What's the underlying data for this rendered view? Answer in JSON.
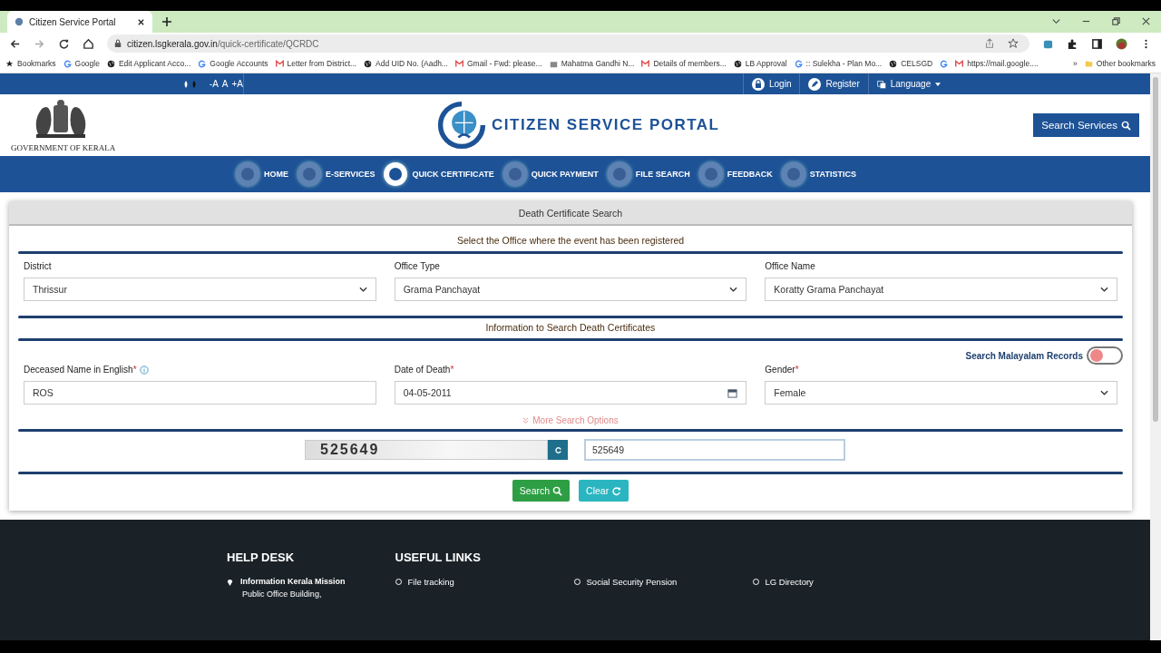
{
  "browser": {
    "tab_title": "Citizen Service Portal",
    "url_host": "citizen.lsgkerala.gov.in",
    "url_path": "/quick-certificate/QCRDC",
    "bookmarks": [
      {
        "label": "Bookmarks",
        "kind": "star"
      },
      {
        "label": "Google",
        "kind": "g"
      },
      {
        "label": "Edit Applicant Acco...",
        "kind": "globe"
      },
      {
        "label": "Google Accounts",
        "kind": "g"
      },
      {
        "label": "Letter from District...",
        "kind": "mail"
      },
      {
        "label": "Add UID No. (Aadh...",
        "kind": "globe"
      },
      {
        "label": "Gmail - Fwd: please...",
        "kind": "mail"
      },
      {
        "label": "Mahatma Gandhi N...",
        "kind": "site"
      },
      {
        "label": "Details of members...",
        "kind": "mail"
      },
      {
        "label": "LB Approval",
        "kind": "globe"
      },
      {
        "label": ":: Sulekha - Plan Mo...",
        "kind": "g"
      },
      {
        "label": "CELSGD",
        "kind": "globe"
      },
      {
        "kind": "g"
      },
      {
        "label": "https://mail.google....",
        "kind": "mail"
      }
    ],
    "overflow": "»",
    "other_bookmarks": "Other bookmarks"
  },
  "topbar": {
    "font_sizes": [
      "-A",
      "A",
      "+A"
    ],
    "login": "Login",
    "register": "Register",
    "language": "Language"
  },
  "header": {
    "org": "GOVERNMENT OF KERALA",
    "portal_title": "CITIZEN SERVICE PORTAL",
    "search_services": "Search Services"
  },
  "nav": [
    {
      "label": "HOME",
      "selected": false
    },
    {
      "label": "E-SERVICES",
      "selected": false
    },
    {
      "label": "QUICK CERTIFICATE",
      "selected": true
    },
    {
      "label": "QUICK PAYMENT",
      "selected": false
    },
    {
      "label": "FILE SEARCH",
      "selected": false
    },
    {
      "label": "FEEDBACK",
      "selected": false
    },
    {
      "label": "STATISTICS",
      "selected": false
    }
  ],
  "form": {
    "title": "Death Certificate Search",
    "office_heading": "Select the Office where the event has been registered",
    "office_fields": [
      {
        "label": "District",
        "value": "Thrissur",
        "kind": "select",
        "required": false
      },
      {
        "label": "Office Type",
        "value": "Grama Panchayat",
        "kind": "select",
        "required": false
      },
      {
        "label": "Office Name",
        "value": "Koratty Grama Panchayat",
        "kind": "select",
        "required": false
      }
    ],
    "info_heading": "Information to Search Death Certificates",
    "malayalam_toggle": {
      "label": "Search Malayalam Records",
      "on": false
    },
    "search_fields": [
      {
        "label": "Deceased Name in English",
        "value": "ROS",
        "kind": "text",
        "required": true,
        "info": true
      },
      {
        "label": "Date of Death",
        "value": "04-05-2011",
        "kind": "date",
        "required": true
      },
      {
        "label": "Gender",
        "value": "Female",
        "kind": "select",
        "required": true
      }
    ],
    "required_mark": "*",
    "more_options": "More Search Options",
    "captcha": {
      "code": "525649",
      "value": "525649"
    },
    "buttons": [
      {
        "label": "Search",
        "kind": "search"
      },
      {
        "label": "Clear",
        "kind": "clear"
      }
    ]
  },
  "footer": {
    "help_desk": {
      "heading": "HELP DESK",
      "org": "Information Kerala Mission",
      "address": "Public Office Building,"
    },
    "useful_links": {
      "heading": "USEFUL LINKS",
      "links": [
        "File tracking",
        "Social Security Pension",
        "LG Directory"
      ]
    }
  }
}
